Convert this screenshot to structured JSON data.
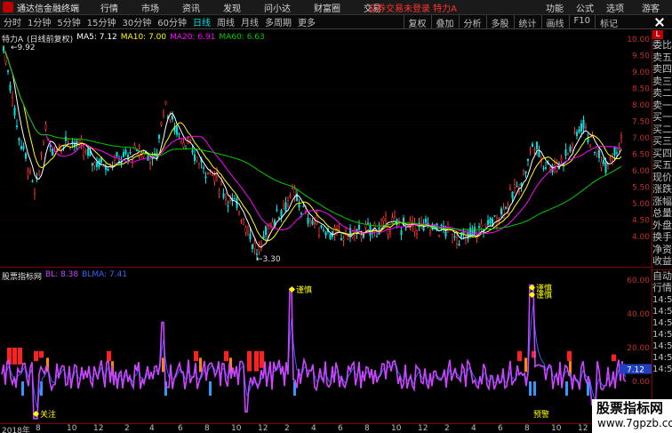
{
  "app": {
    "title": "通达信金融终端",
    "guest": "游客"
  },
  "menu": [
    "行情",
    "市场",
    "资讯",
    "发现",
    "问小达",
    "财富圈",
    "交易"
  ],
  "notice": "证券交易未登录  特力A",
  "top_right": [
    "功能",
    "公式",
    "选项"
  ],
  "toolbar": {
    "periods": [
      "分时",
      "1分钟",
      "5分钟",
      "15分钟",
      "30分钟",
      "60分钟",
      "日线",
      "周线",
      "月线",
      "多周期",
      "更多"
    ],
    "active_period": "日线",
    "tools": [
      "复权",
      "叠加",
      "分析",
      "多股",
      "统计",
      "画线",
      "F10",
      "标记"
    ]
  },
  "main_legend": {
    "stock": "特力A",
    "adj": "(日线前复权)",
    "ma5": "MA5: 7.12",
    "ma10": "MA10: 7.00",
    "ma20": "MA20: 6.91",
    "ma60": "MA60: 6.63"
  },
  "main_axis": [
    "10.00",
    "9.50",
    "9.00",
    "8.50",
    "8.00",
    "7.50",
    "7.00",
    "6.50",
    "6.00",
    "5.50",
    "5.00",
    "4.50",
    "4.00"
  ],
  "annotations": {
    "high": "9.92",
    "low": "3.30"
  },
  "indicator": {
    "name": "股票指标网",
    "bl": "BL: 8.38",
    "blma": "BLMA: 7.41",
    "axis": [
      "60.00",
      "40.00",
      "20.00",
      "0.00",
      "-20.00"
    ],
    "current": "7.12",
    "labels": {
      "caution1": "谨慎",
      "caution2": "谨慎",
      "caution3": "谨慎",
      "attention": "关注",
      "warn": "预警"
    }
  },
  "xaxis": [
    "2018年",
    "8",
    "10",
    "12",
    "2",
    "4",
    "6",
    "8",
    "10",
    "12",
    "2",
    "4",
    "6",
    "8",
    "10",
    "12",
    "2",
    "4",
    "6",
    "8",
    "10",
    "12",
    "2",
    "4",
    "6",
    "8"
  ],
  "right_panel": {
    "badge": "L",
    "items": [
      "委比",
      "卖五",
      "卖四",
      "卖三",
      "卖二",
      "卖一",
      "买一",
      "买二",
      "买三",
      "买四",
      "买五",
      "现价",
      "涨跌",
      "涨幅",
      "总量",
      "外盘",
      "换手",
      "净资",
      "收益"
    ],
    "auto": "自动",
    "ticker": "行情",
    "times": [
      "14:56",
      "14:56",
      "14:56",
      "14:56",
      "14:56",
      "14:56",
      "14:56"
    ]
  },
  "watermark": {
    "title": "股票指标网",
    "url": "www.7gpzb.com"
  },
  "colors": {
    "up": "#ff3030",
    "down": "#00e0e0",
    "ma5": "#ffffff",
    "ma10": "#ffff00",
    "ma20": "#ff00ff",
    "ma60": "#00cc00",
    "bl": "#cc44ff",
    "blma": "#3366ff"
  }
}
